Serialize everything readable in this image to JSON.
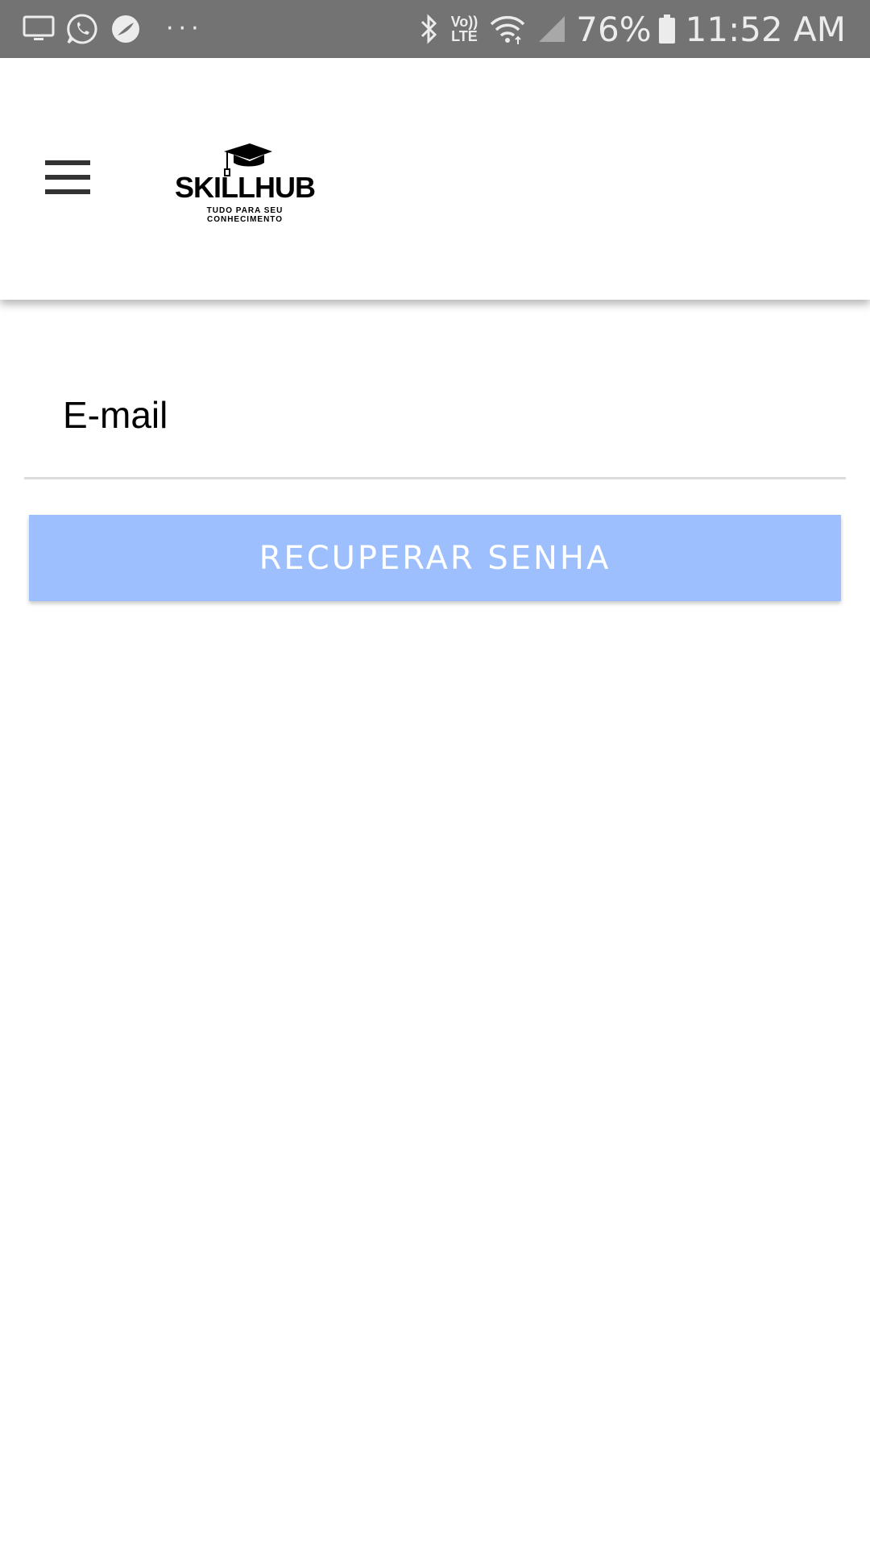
{
  "status_bar": {
    "battery_percent": "76%",
    "time": "11:52 AM",
    "network_label_top": "Vo))",
    "network_label_bottom": "LTE",
    "overflow_dots": "···",
    "icons": [
      "monitor-icon",
      "whatsapp-icon",
      "app-notification-icon",
      "bluetooth-icon",
      "volte-lte-icon",
      "wifi-icon",
      "cell-signal-icon",
      "battery-icon"
    ]
  },
  "app_bar": {
    "menu_icon": "hamburger-menu-icon",
    "logo": {
      "title": "SKILLHUB",
      "subtitle_line1": "TUDO PARA SEU",
      "subtitle_line2": "CONHECIMENTO",
      "icon": "graduation-cap-icon"
    }
  },
  "form": {
    "email_placeholder": "E-mail",
    "email_value": "",
    "submit_label": "RECUPERAR SENHA"
  },
  "colors": {
    "status_bar_bg": "#737373",
    "button_bg": "#9dbffd",
    "button_text": "#ffffff",
    "underline": "#dcdcdc"
  }
}
